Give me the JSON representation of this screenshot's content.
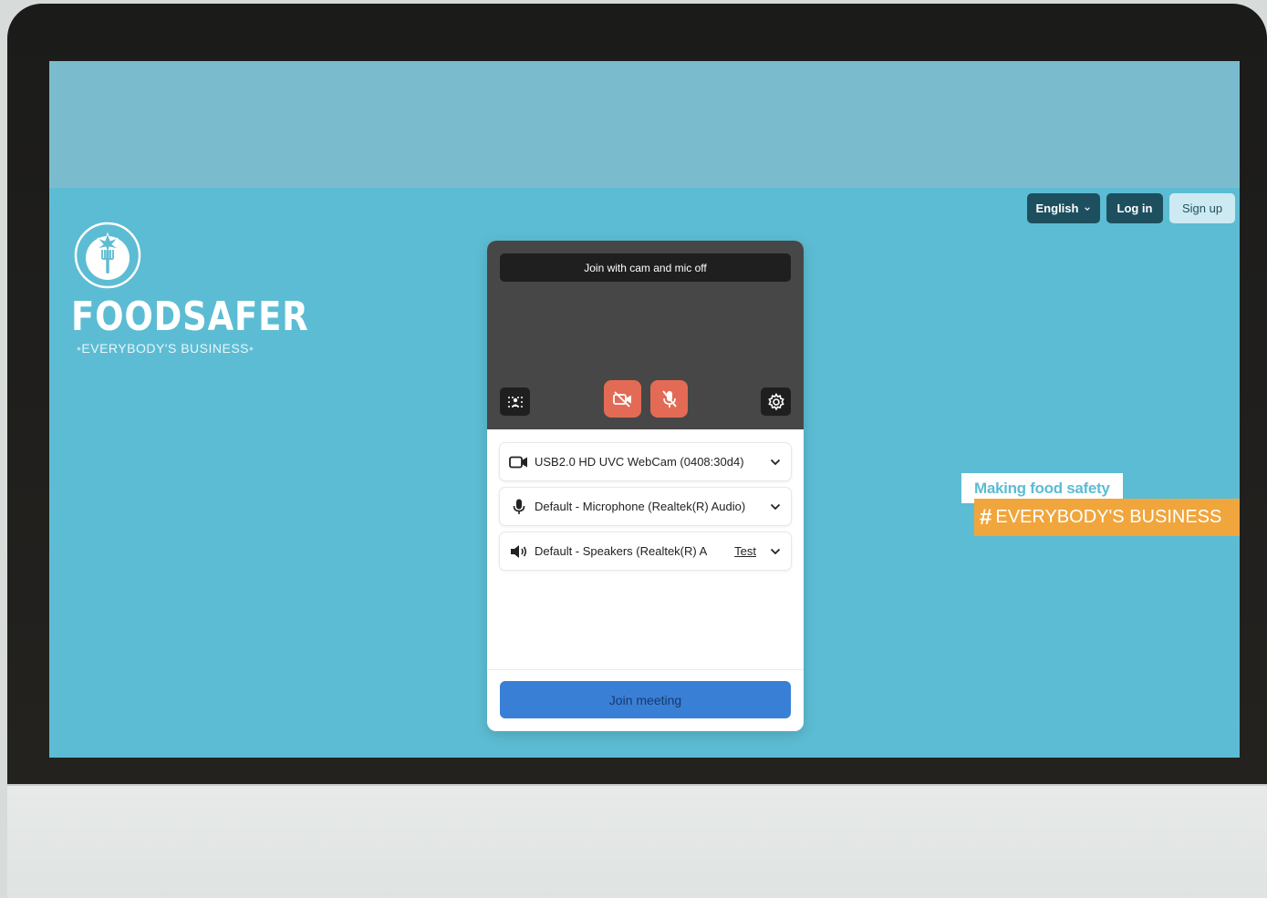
{
  "header": {
    "language_label": "English",
    "login_label": "Log in",
    "signup_label": "Sign up"
  },
  "brand": {
    "name": "FOODSAFER",
    "tagline": "EVERYBODY'S BUSINESS"
  },
  "prejoin": {
    "banner_text": "Join with cam and mic off",
    "controls": {
      "background_effects_icon": "background-blur-icon",
      "camera_toggle_icon": "camera-off-icon",
      "mic_toggle_icon": "mic-off-icon",
      "settings_icon": "gear-icon",
      "camera_state": "off",
      "mic_state": "off"
    },
    "devices": [
      {
        "type": "camera",
        "icon": "camera-icon",
        "label": "USB2.0 HD UVC WebCam (0408:30d4)"
      },
      {
        "type": "microphone",
        "icon": "microphone-icon",
        "label": "Default - Microphone (Realtek(R) Audio)"
      },
      {
        "type": "speaker",
        "icon": "speaker-icon",
        "label": "Default - Speakers (Realtek(R) A",
        "action": "Test"
      }
    ],
    "join_label": "Join meeting"
  },
  "slogan": {
    "line1": "Making food safety",
    "hash": "#",
    "line2": "EVERYBODY'S BUSINESS"
  },
  "colors": {
    "page_background": "#5cbcd3",
    "top_band": "#7abcce",
    "header_button_dark": "#1e4f5f",
    "signup_button": "#cdeaf3",
    "preview_dark": "#474747",
    "toggle_off_red": "#e36b55",
    "join_button": "#3a7fd6",
    "slogan_orange": "#f0a63c"
  }
}
